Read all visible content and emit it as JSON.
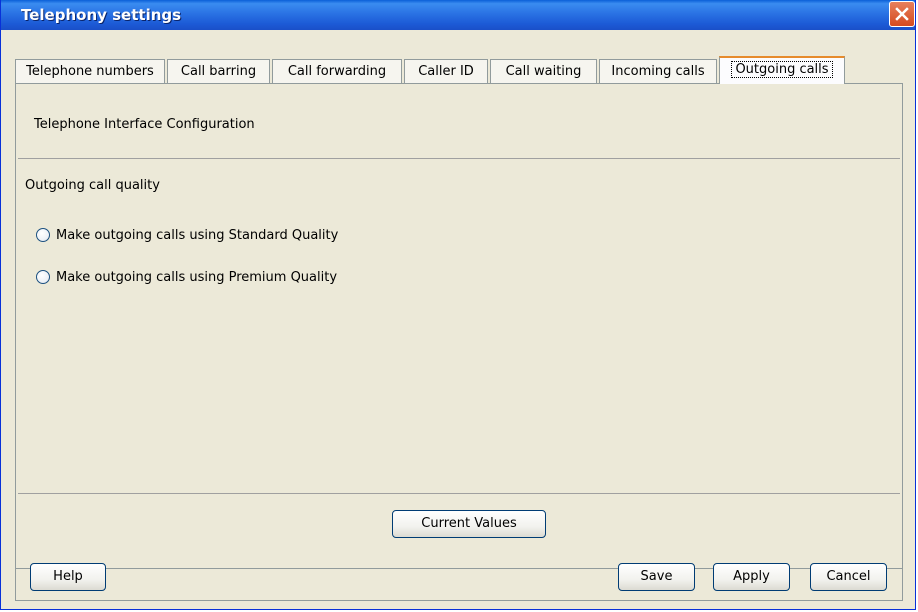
{
  "window": {
    "title": "Telephony settings"
  },
  "tabs": [
    {
      "label": "Telephone numbers"
    },
    {
      "label": "Call barring"
    },
    {
      "label": "Call forwarding"
    },
    {
      "label": "Caller ID"
    },
    {
      "label": "Call waiting"
    },
    {
      "label": "Incoming calls"
    },
    {
      "label": "Outgoing calls",
      "active": true
    }
  ],
  "panel": {
    "header": "Telephone Interface Configuration",
    "group_title": "Outgoing call quality",
    "options": [
      {
        "label": "Make outgoing calls using Standard Quality",
        "selected": false
      },
      {
        "label": "Make outgoing calls using Premium Quality",
        "selected": false
      }
    ],
    "current_values_label": "Current Values"
  },
  "footer": {
    "help_label": "Help",
    "save_label": "Save",
    "apply_label": "Apply",
    "cancel_label": "Cancel"
  },
  "icons": {
    "close": "close-icon"
  },
  "colors": {
    "titlebar": "#2a72e4",
    "active_tab_accent": "#e68b2c",
    "close_button": "#d44a20",
    "window_bg": "#ece9d8"
  }
}
